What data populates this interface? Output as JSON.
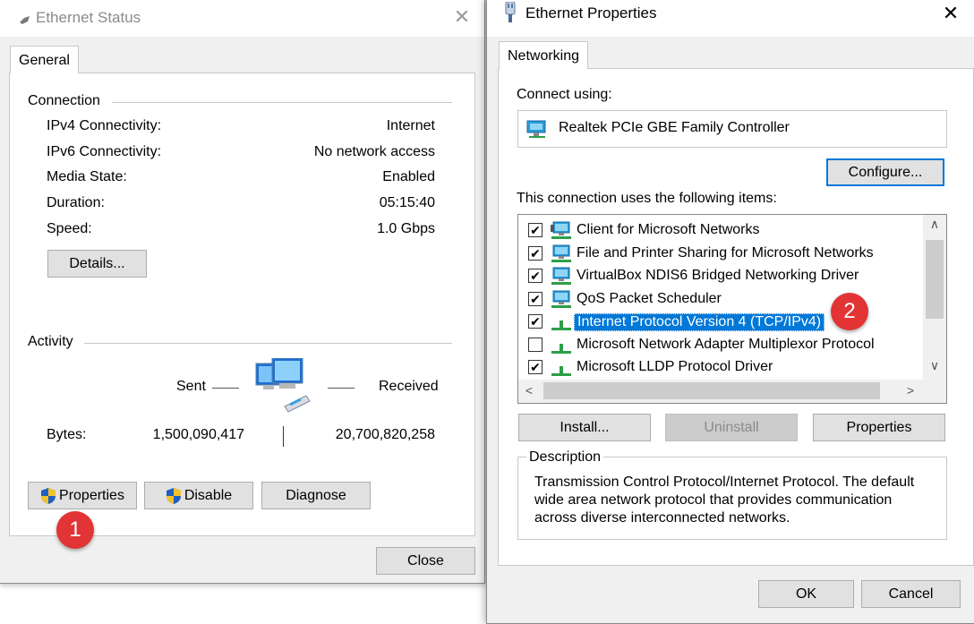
{
  "status_window": {
    "title": "Ethernet Status",
    "tab": "General",
    "connection_heading": "Connection",
    "rows": [
      {
        "label": "IPv4 Connectivity:",
        "value": "Internet"
      },
      {
        "label": "IPv6 Connectivity:",
        "value": "No network access"
      },
      {
        "label": "Media State:",
        "value": "Enabled"
      },
      {
        "label": "Duration:",
        "value": "05:15:40"
      },
      {
        "label": "Speed:",
        "value": "1.0 Gbps"
      }
    ],
    "details_button": "Details...",
    "activity_heading": "Activity",
    "sent_label": "Sent",
    "received_label": "Received",
    "bytes_label": "Bytes:",
    "bytes_sent": "1,500,090,417",
    "bytes_received": "20,700,820,258",
    "properties_button": "Properties",
    "disable_button": "Disable",
    "diagnose_button": "Diagnose",
    "close_button": "Close",
    "badge": "1"
  },
  "properties_window": {
    "title": "Ethernet Properties",
    "tab": "Networking",
    "connect_using_label": "Connect using:",
    "adapter_name": "Realtek PCIe GBE Family Controller",
    "configure_button": "Configure...",
    "items_label": "This connection uses the following items:",
    "items": [
      {
        "label": "Client for Microsoft Networks",
        "checked": true,
        "icon": "network-client-icon"
      },
      {
        "label": "File and Printer Sharing for Microsoft Networks",
        "checked": true,
        "icon": "network-service-icon"
      },
      {
        "label": "VirtualBox NDIS6 Bridged Networking Driver",
        "checked": true,
        "icon": "network-service-icon"
      },
      {
        "label": "QoS Packet Scheduler",
        "checked": true,
        "icon": "network-service-icon"
      },
      {
        "label": "Internet Protocol Version 4 (TCP/IPv4)",
        "checked": true,
        "icon": "protocol-icon",
        "selected": true
      },
      {
        "label": "Microsoft Network Adapter Multiplexor Protocol",
        "checked": false,
        "icon": "protocol-icon"
      },
      {
        "label": "Microsoft LLDP Protocol Driver",
        "checked": true,
        "icon": "protocol-icon"
      }
    ],
    "install_button": "Install...",
    "uninstall_button": "Uninstall",
    "properties_button": "Properties",
    "description_heading": "Description",
    "description_text": "Transmission Control Protocol/Internet Protocol. The default wide area network protocol that provides communication across diverse interconnected networks.",
    "ok_button": "OK",
    "cancel_button": "Cancel",
    "badge": "2"
  },
  "colors": {
    "accent": "#0078d7",
    "badge": "#e23434",
    "window_bg": "#f0f0f0"
  }
}
